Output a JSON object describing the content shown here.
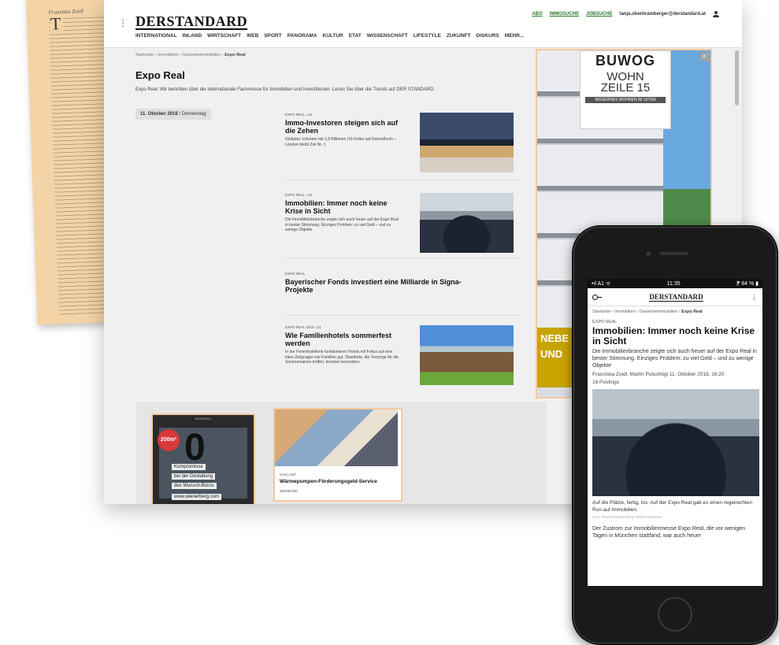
{
  "browser": {
    "logo": "DERSTANDARD",
    "nav": [
      "INTERNATIONAL",
      "INLAND",
      "WIRTSCHAFT",
      "WEB",
      "SPORT",
      "PANORAMA",
      "KULTUR",
      "ETAT",
      "WISSENSCHAFT",
      "LIFESTYLE",
      "ZUKUNFT",
      "DISKURS",
      "MEHR..."
    ],
    "toplinks": [
      "ABO",
      "IMMOSUCHE",
      "JOBSUCHE"
    ],
    "user": "tanja.oberbramberger@derstandard.at",
    "breadcrumb": {
      "path": "Startseite › Immobilien › Gewerbeimmobilien ›",
      "current": "Expo Real"
    },
    "title": "Expo Real",
    "intro": "Expo Real: Wir berichten über die internationale Fachmesse für Immobilien und Investitionen. Lesen Sie über die Trends auf DER STANDARD.",
    "date": {
      "day": "11. Oktober 2018",
      "weekday": "/ Donnerstag"
    },
    "articles": [
      {
        "kicker": "EXPO REAL  ⌂31",
        "title": "Immo-Investoren steigen sich auf die Zehen",
        "teaser": "Globales Volumen mit 1,8 Billionen US-Dollar auf Rekordhoch – London bleibt Ziel Nr. 1"
      },
      {
        "kicker": "EXPO REAL  ⌂16",
        "title": "Immobilien: Immer noch keine Krise in Sicht",
        "teaser": "Die Immobilienbranche zeigte sich auch heuer auf der Expo Real in bester Stimmung. Einziges Problem: zu viel Geld – und zu wenige Objekte"
      },
      {
        "kicker": "EXPO REAL",
        "title": "Bayerischer Fonds investiert eine Milliarde in Signa-Projekte",
        "teaser": ""
      },
      {
        "kicker": "EXPO REAL 2018  ⌂31",
        "title": "Wie Familienhotels sommerfest werden",
        "teaser": "In der Ferienhotellerie funktionieren Hotels mit Fokus auf eine klare Zielgruppe wie Familien gut. Standorte, die Vorsorge für die Sommersaison treffen, boomen besonders."
      }
    ],
    "promo": {
      "ad_label": "WERBUNG",
      "badge": "200m²",
      "big": "0",
      "lines": [
        "Kompromisse",
        "bei der Gestaltung",
        "des Wunsch-Büros",
        "www.wienerberg.com"
      ]
    },
    "card": {
      "kicker": "VAILLANT",
      "title": "Wärmepumpen-Förderungsgeld-Service",
      "label": "WERBUNG"
    },
    "ad": {
      "brand": "BUWOG",
      "wohn": "WOHN",
      "zeile": "ZEILE 15",
      "sub": "MODERNES WOHNEN IM 15TEN",
      "overlay": "NEBE UND",
      "close": "×"
    }
  },
  "phone": {
    "status": {
      "left": "•ıl A1 ᯤ",
      "time": "11:35",
      "right": "⁋ 84 % ▮"
    },
    "logo": "DERSTANDARD",
    "breadcrumb": {
      "path": "Startseite › Immobilien › Gewerbeimmobilien ›",
      "current": "Expo Real"
    },
    "kicker": "EXPO REAL",
    "title": "Immobilien: Immer noch keine Krise in Sicht",
    "teaser": "Die Immobilienbranche zeigte sich auch heuer auf der Expo Real in bester Stimmung. Einziges Problem: zu viel Geld – und zu wenige Objekte",
    "authors": "Franziska Zoidl, Martin Putschögl",
    "datetime": "11. Oktober 2018, 16:20",
    "postings": "16 Postings",
    "caption": "Auf die Plätze, fertig, los: Auf der Expo Real gab es einen regelrechten Run auf Immobilien.",
    "credit": "Foto: Thomas Plettenberg / Messe München",
    "para": "Der Zustrom zur Immobilienmesse Expo Real, die vor wenigen Tagen in München stattfand, war auch heuer"
  },
  "paper": {
    "byline": "Franziska Zoidl",
    "dropcap": "T"
  },
  "colors": {
    "accent_border": "#f7c89a",
    "link_green": "#2a7a2a",
    "ad_overlay": "#c8a400"
  }
}
